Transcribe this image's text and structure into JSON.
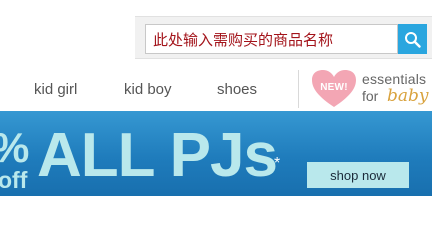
{
  "search": {
    "value": "此处输入需购买的商品名称",
    "button_icon": "search-icon"
  },
  "nav": {
    "items": [
      {
        "label": "kid girl"
      },
      {
        "label": "kid boy"
      },
      {
        "label": "shoes"
      }
    ],
    "essentials": {
      "badge_text": "NEW!",
      "line1": "essentials",
      "line2_for": "for",
      "line2_baby": "baby"
    }
  },
  "banner": {
    "percent_fragment": "%",
    "off_fragment": "off",
    "headline": "ALL PJs",
    "asterisk": "*",
    "cta_label": "shop now"
  },
  "colors": {
    "search_button": "#2aa6df",
    "search_text": "#a3131a",
    "banner_blue": "#1f7cbc",
    "promo_aqua": "#b9e8ec",
    "heart_pink": "#f3a6b4",
    "baby_gold": "#d9a33f"
  }
}
